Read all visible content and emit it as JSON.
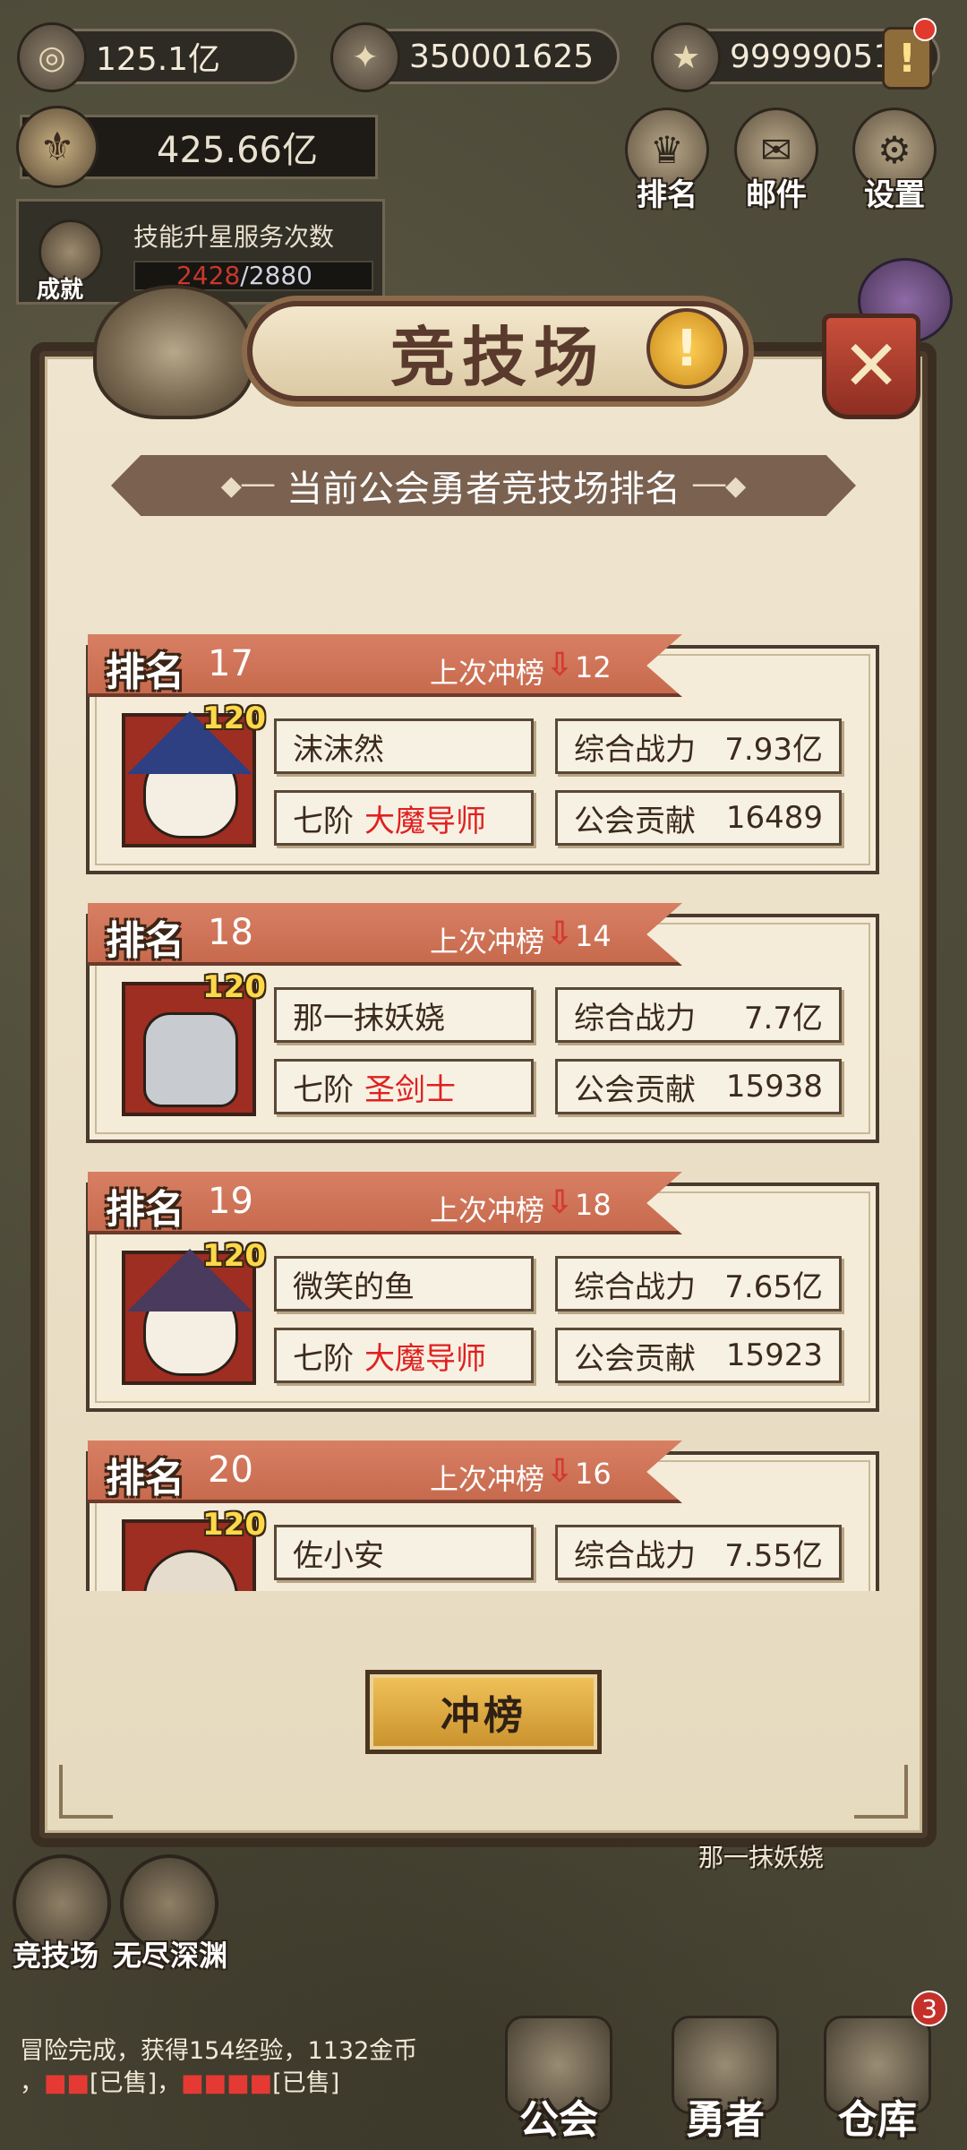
{
  "resources": {
    "gold": "125.1亿",
    "gem": "350001625",
    "star": "99999051"
  },
  "power_total": "425.66亿",
  "top_buttons": {
    "rank": "排名",
    "mail": "邮件",
    "settings": "设置"
  },
  "service": {
    "badge": "成就",
    "title": "技能升星服务次数",
    "current": "2428",
    "max": "/2880"
  },
  "panel": {
    "title": "竞技场",
    "subtitle": "当前公会勇者竞技场排名",
    "close_symbol": "✕",
    "info_symbol": "!"
  },
  "labels": {
    "rank": "排名",
    "last_charge": "上次冲榜",
    "power": "综合战力",
    "contribution": "公会贡献",
    "down_arrow": "⇩"
  },
  "entries": [
    {
      "rank": "17",
      "last": "12",
      "level": "120",
      "name": "沫沫然",
      "tier": "七阶",
      "class": "大魔导师",
      "power": "7.93亿",
      "contribution": "16489"
    },
    {
      "rank": "18",
      "last": "14",
      "level": "120",
      "name": "那一抹妖娆",
      "tier": "七阶",
      "class": "圣剑士",
      "power": "7.7亿",
      "contribution": "15938"
    },
    {
      "rank": "19",
      "last": "18",
      "level": "120",
      "name": "微笑的鱼",
      "tier": "七阶",
      "class": "大魔导师",
      "power": "7.65亿",
      "contribution": "15923"
    },
    {
      "rank": "20",
      "last": "16",
      "level": "120",
      "name": "佐小安",
      "tier": "",
      "class": "",
      "power": "7.55亿",
      "contribution": ""
    }
  ],
  "charge_button": "冲榜",
  "bottom": {
    "arena": "竞技场",
    "abyss": "无尽深渊",
    "hero_name_tag": "那一抹妖娆",
    "log_line1": "冒险完成，获得154经验，1132金币",
    "log_line2_a": "，",
    "log_line2_b": "[已售]，",
    "log_line2_c": "[已售]"
  },
  "nav": {
    "guild": "公会",
    "hero": "勇者",
    "warehouse": "仓库",
    "warehouse_badge": "3"
  },
  "colors": {
    "accent_red": "#e02020",
    "rank_banner": "#d87f63",
    "button_gold": "#f2c35a"
  }
}
